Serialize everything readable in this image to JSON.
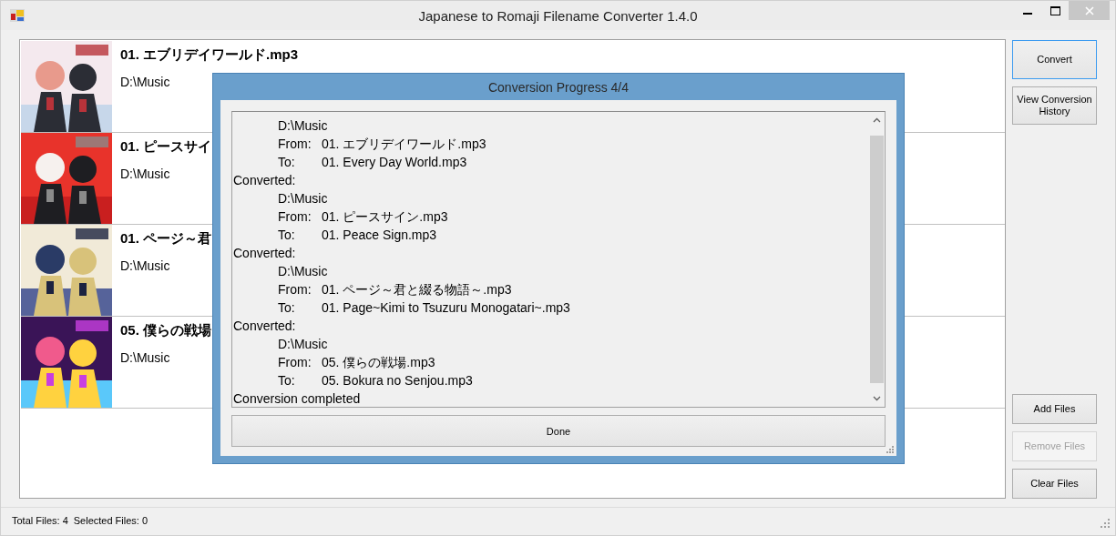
{
  "window": {
    "title": "Japanese to Romaji Filename Converter 1.4.0"
  },
  "files": [
    {
      "title": "01. エブリデイワールド.mp3",
      "path": "D:\\Music"
    },
    {
      "title": "01. ピースサイ",
      "path": "D:\\Music"
    },
    {
      "title": "01. ページ～君",
      "path": "D:\\Music"
    },
    {
      "title": "05. 僕らの戦場",
      "path": "D:\\Music"
    }
  ],
  "side_buttons_top": [
    {
      "label": "Convert",
      "focused": true,
      "disabled": false
    },
    {
      "label": "View Conversion History",
      "focused": false,
      "disabled": false
    }
  ],
  "side_buttons_bottom": [
    {
      "label": "Add Files",
      "focused": false,
      "disabled": false
    },
    {
      "label": "Remove Files",
      "focused": false,
      "disabled": true
    },
    {
      "label": "Clear Files",
      "focused": false,
      "disabled": false
    }
  ],
  "status_bar": {
    "total": "Total Files: 4",
    "selected": "Selected Files: 0"
  },
  "dialog": {
    "title": "Conversion Progress 4/4",
    "log": [
      {
        "kind": "path",
        "text": "D:\\Music"
      },
      {
        "kind": "mapping",
        "label": "From:",
        "value": "01. エブリデイワールド.mp3"
      },
      {
        "kind": "mapping",
        "label": "To:",
        "value": "01. Every Day World.mp3"
      },
      {
        "kind": "heading",
        "text": "Converted:"
      },
      {
        "kind": "path",
        "text": "D:\\Music"
      },
      {
        "kind": "mapping",
        "label": "From:",
        "value": "01. ピースサイン.mp3"
      },
      {
        "kind": "mapping",
        "label": "To:",
        "value": "01. Peace Sign.mp3"
      },
      {
        "kind": "heading",
        "text": "Converted:"
      },
      {
        "kind": "path",
        "text": "D:\\Music"
      },
      {
        "kind": "mapping",
        "label": "From:",
        "value": "01. ページ～君と綴る物語～.mp3"
      },
      {
        "kind": "mapping",
        "label": "To:",
        "value": "01. Page~Kimi to Tsuzuru Monogatari~.mp3"
      },
      {
        "kind": "heading",
        "text": "Converted:"
      },
      {
        "kind": "path",
        "text": "D:\\Music"
      },
      {
        "kind": "mapping",
        "label": "From:",
        "value": "05. 僕らの戦場.mp3"
      },
      {
        "kind": "mapping",
        "label": "To:",
        "value": "05. Bokura no Senjou.mp3"
      },
      {
        "kind": "heading",
        "text": "Conversion completed"
      }
    ],
    "button": "Done"
  }
}
